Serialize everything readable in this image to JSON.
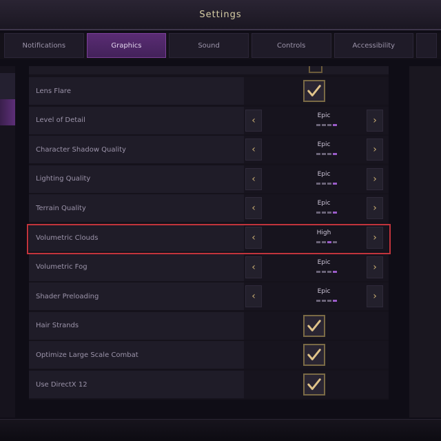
{
  "window": {
    "title": "Settings"
  },
  "tabs": [
    {
      "label": "Notifications",
      "active": false
    },
    {
      "label": "Graphics",
      "active": true
    },
    {
      "label": "Sound",
      "active": false
    },
    {
      "label": "Controls",
      "active": false
    },
    {
      "label": "Accessibility",
      "active": false
    }
  ],
  "settings": [
    {
      "label": "Lens Flare",
      "type": "checkbox",
      "checked": true
    },
    {
      "label": "Level of Detail",
      "type": "selector",
      "value": "Epic",
      "level": 4,
      "levels": 4
    },
    {
      "label": "Character Shadow Quality",
      "type": "selector",
      "value": "Epic",
      "level": 4,
      "levels": 4
    },
    {
      "label": "Lighting Quality",
      "type": "selector",
      "value": "Epic",
      "level": 4,
      "levels": 4
    },
    {
      "label": "Terrain Quality",
      "type": "selector",
      "value": "Epic",
      "level": 4,
      "levels": 4
    },
    {
      "label": "Volumetric Clouds",
      "type": "selector",
      "value": "High",
      "level": 3,
      "levels": 4,
      "highlighted": true
    },
    {
      "label": "Volumetric Fog",
      "type": "selector",
      "value": "Epic",
      "level": 4,
      "levels": 4
    },
    {
      "label": "Shader Preloading",
      "type": "selector",
      "value": "Epic",
      "level": 4,
      "levels": 4
    },
    {
      "label": "Hair Strands",
      "type": "checkbox",
      "checked": true
    },
    {
      "label": "Optimize Large Scale Combat",
      "type": "checkbox",
      "checked": true
    },
    {
      "label": "Use DirectX 12",
      "type": "checkbox",
      "checked": true
    }
  ],
  "colors": {
    "accent": "#7b3f98",
    "highlight_border": "#c2343c",
    "checkbox_border": "#7a6a45",
    "check": "#e0c38a"
  }
}
